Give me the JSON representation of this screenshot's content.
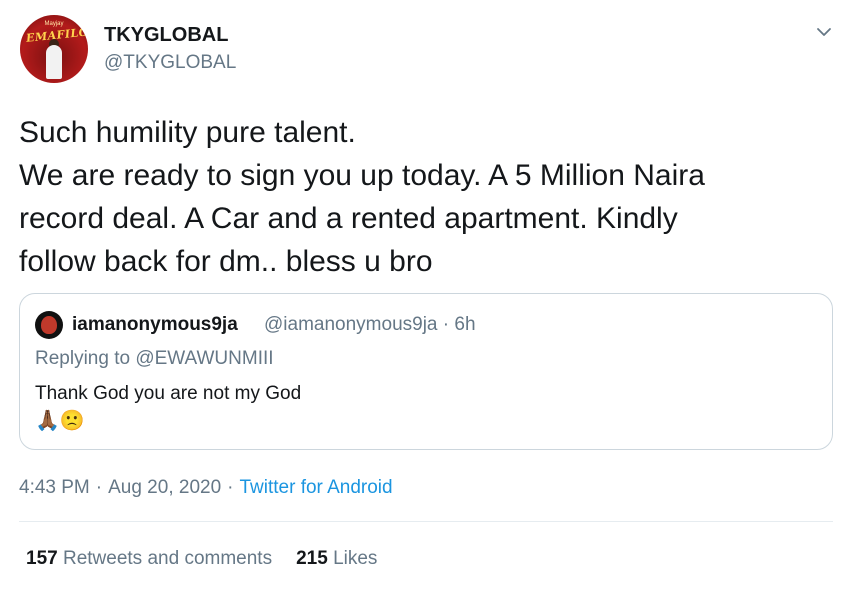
{
  "author": {
    "display_name": "TKYGLOBAL",
    "handle": "@TKYGLOBAL",
    "avatar_banner": "EMAFILOMI",
    "avatar_small_text": "Mayjay"
  },
  "menu_icon": "chevron-down-icon",
  "tweet_lines": [
    "Such humility pure talent.",
    "We are ready to sign you up today. A 5 Million Naira",
    "record deal. A Car and a rented apartment. Kindly",
    "follow back for dm.. bless u bro"
  ],
  "quoted": {
    "display_name": "iamanonymous9ja",
    "handle_time": "@iamanonymous9ja · 6h",
    "replying_to": "Replying to @EWAWUNMIII",
    "text": "Thank God you are not my God",
    "emojis": "🙏🏾🙁"
  },
  "meta": {
    "time": "4:43 PM",
    "sep": "·",
    "date": "Aug 20, 2020",
    "source": "Twitter for Android"
  },
  "stats": {
    "retweets_count": "157",
    "retweets_label": "Retweets and comments",
    "likes_count": "215",
    "likes_label": "Likes"
  },
  "colors": {
    "text": "#14171a",
    "secondary": "#657786",
    "link": "#1b95e0",
    "border": "#ccd6dd"
  }
}
